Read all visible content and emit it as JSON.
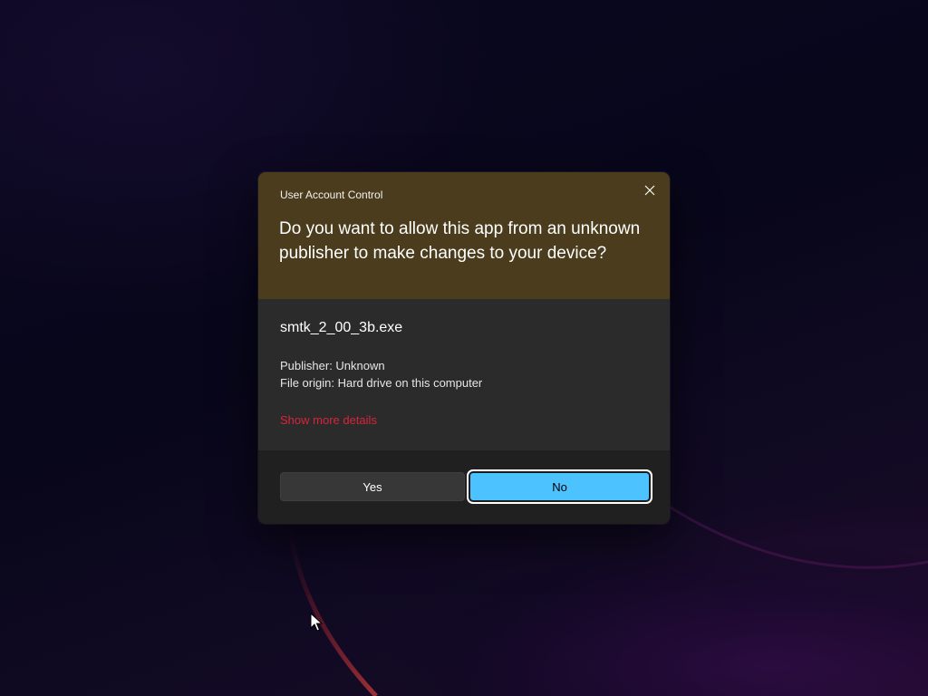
{
  "desktop": {
    "wallpaper": "dark-bloom-wallpaper"
  },
  "dialog": {
    "title": "User Account Control",
    "question": "Do you want to allow this app from an unknown publisher to make changes to your device?",
    "close_icon": "close-icon",
    "file_name": "smtk_2_00_3b.exe",
    "publisher": "Publisher: Unknown",
    "file_origin": "File origin: Hard drive on this computer",
    "details_link": "Show more details",
    "buttons": {
      "yes": "Yes",
      "no": "No"
    },
    "colors": {
      "header_background": "#4a3c1c",
      "body_background": "#2b2b2b",
      "footer_background": "#202020",
      "link": "#d8243a",
      "primary_button": "#4cc2ff"
    }
  },
  "cursor": {
    "icon": "mouse-pointer-icon"
  }
}
